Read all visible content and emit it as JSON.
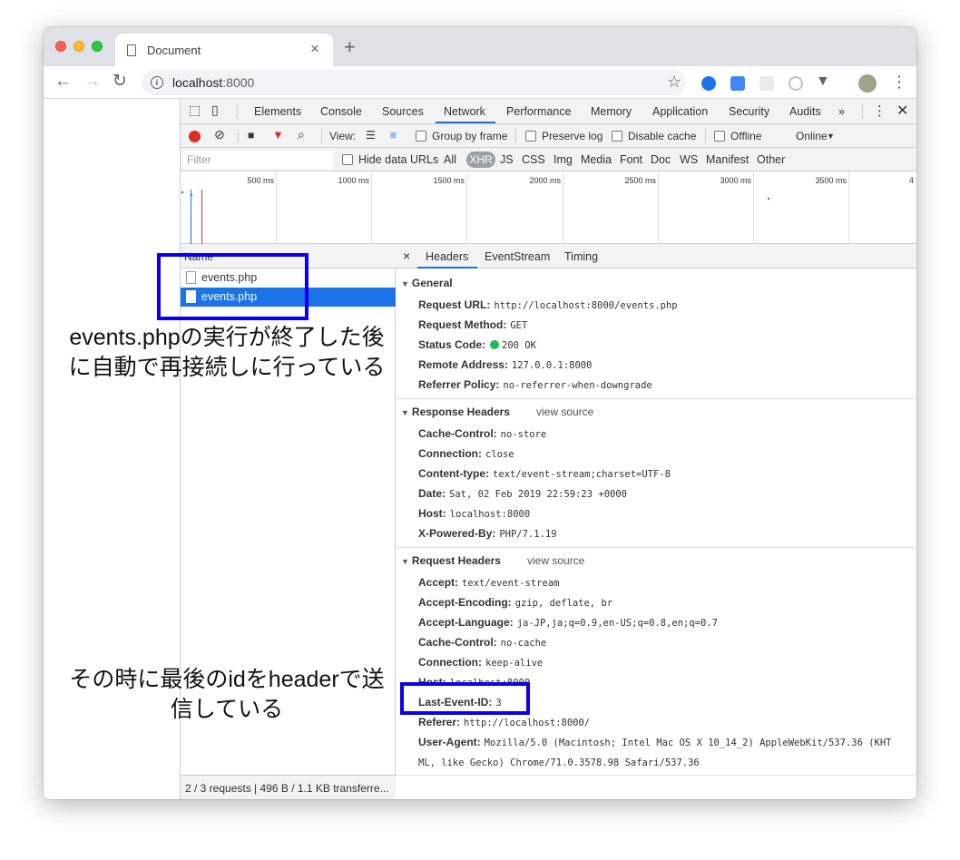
{
  "browser": {
    "tab_title": "Document",
    "url_host": "localhost",
    "url_port": ":8000"
  },
  "devtools": {
    "tabs": [
      "Elements",
      "Console",
      "Sources",
      "Network",
      "Performance",
      "Memory",
      "Application",
      "Security",
      "Audits",
      "»"
    ],
    "active_tab": "Network",
    "toolbar": {
      "view_label": "View:",
      "group_by_frame": "Group by frame",
      "preserve_log": "Preserve log",
      "disable_cache": "Disable cache",
      "offline": "Offline",
      "throttle": "Online"
    },
    "filter": {
      "placeholder": "Filter",
      "hide_data_urls": "Hide data URLs",
      "types": [
        "All",
        "XHR",
        "JS",
        "CSS",
        "Img",
        "Media",
        "Font",
        "Doc",
        "WS",
        "Manifest",
        "Other"
      ],
      "active_type": "XHR"
    },
    "overview_ticks": [
      "500 ms",
      "1000 ms",
      "1500 ms",
      "2000 ms",
      "2500 ms",
      "3000 ms",
      "3500 ms",
      "4"
    ],
    "request_list": {
      "header": "Name",
      "rows": [
        "events.php",
        "events.php"
      ],
      "selected_index": 1,
      "status": "2 / 3 requests | 496 B / 1.1 KB transferre..."
    },
    "detail": {
      "tabs": [
        "Headers",
        "EventStream",
        "Timing"
      ],
      "active_tab": "Headers",
      "close": "×",
      "view_source": "view source",
      "general": {
        "title": "General",
        "rows": [
          {
            "k": "Request URL:",
            "v": "http://localhost:8000/events.php"
          },
          {
            "k": "Request Method:",
            "v": "GET"
          },
          {
            "k": "Status Code:",
            "v": "200 OK"
          },
          {
            "k": "Remote Address:",
            "v": "127.0.0.1:8000"
          },
          {
            "k": "Referrer Policy:",
            "v": "no-referrer-when-downgrade"
          }
        ]
      },
      "response_headers": {
        "title": "Response Headers",
        "rows": [
          {
            "k": "Cache-Control:",
            "v": "no-store"
          },
          {
            "k": "Connection:",
            "v": "close"
          },
          {
            "k": "Content-type:",
            "v": "text/event-stream;charset=UTF-8"
          },
          {
            "k": "Date:",
            "v": "Sat, 02 Feb 2019 22:59:23 +0000"
          },
          {
            "k": "Host:",
            "v": "localhost:8000"
          },
          {
            "k": "X-Powered-By:",
            "v": "PHP/7.1.19"
          }
        ]
      },
      "request_headers": {
        "title": "Request Headers",
        "rows": [
          {
            "k": "Accept:",
            "v": "text/event-stream"
          },
          {
            "k": "Accept-Encoding:",
            "v": "gzip, deflate, br"
          },
          {
            "k": "Accept-Language:",
            "v": "ja-JP,ja;q=0.9,en-US;q=0.8,en;q=0.7"
          },
          {
            "k": "Cache-Control:",
            "v": "no-cache"
          },
          {
            "k": "Connection:",
            "v": "keep-alive"
          },
          {
            "k": "Host:",
            "v": "localhost:8000"
          },
          {
            "k": "Last-Event-ID:",
            "v": "3"
          },
          {
            "k": "Referer:",
            "v": "http://localhost:8000/"
          },
          {
            "k": "User-Agent:",
            "v": "Mozilla/5.0 (Macintosh; Intel Mac OS X 10_14_2) AppleWebKit/537.36 (KHT"
          },
          {
            "k": "",
            "v": "ML, like Gecko) Chrome/71.0.3578.98 Safari/537.36"
          }
        ]
      }
    }
  },
  "annotations": {
    "note1_line1": "events.phpの実行が終了した後",
    "note1_line2": "に自動で再接続しに行っている",
    "note2_line1": "その時に最後のidをheaderで送",
    "note2_line2": "信している",
    "box_color": "#0a00f0"
  }
}
